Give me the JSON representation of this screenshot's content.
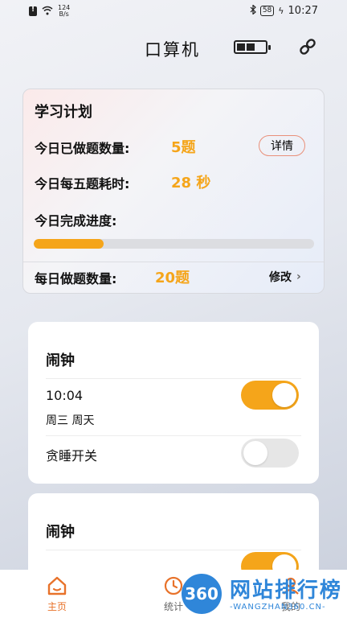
{
  "status_bar": {
    "speed_value": "124",
    "speed_unit": "B/s",
    "battery": "58",
    "time": "10:27"
  },
  "header": {
    "title": "口算机"
  },
  "plan": {
    "title": "学习计划",
    "done_label": "今日已做题数量:",
    "done_value": "5题",
    "detail_label": "详情",
    "time_label": "今日每五题耗时:",
    "time_value": "28 秒",
    "progress_label": "今日完成进度:",
    "progress_fraction": 0.25,
    "daily_label": "每日做题数量:",
    "daily_value": "20题",
    "modify_label": "修改"
  },
  "alarms": [
    {
      "title": "闹钟",
      "time": "10:04",
      "days": "周三 周天",
      "enabled": true,
      "snooze_label": "贪睡开关",
      "snooze": false
    },
    {
      "title": "闹钟",
      "enabled": true
    }
  ],
  "bottom_nav": [
    {
      "label": "主页",
      "active": true,
      "icon": "home-icon"
    },
    {
      "label": "统计",
      "active": false,
      "icon": "clock-icon"
    },
    {
      "label": "我的",
      "active": false,
      "icon": "person-icon"
    }
  ],
  "watermark": {
    "logo": "360",
    "title": "网站排行榜",
    "url": "WANGZHAN360.CN"
  },
  "colors": {
    "accent": "#f5a51a",
    "home_active": "#e8722a",
    "watermark": "#2f86d9"
  }
}
